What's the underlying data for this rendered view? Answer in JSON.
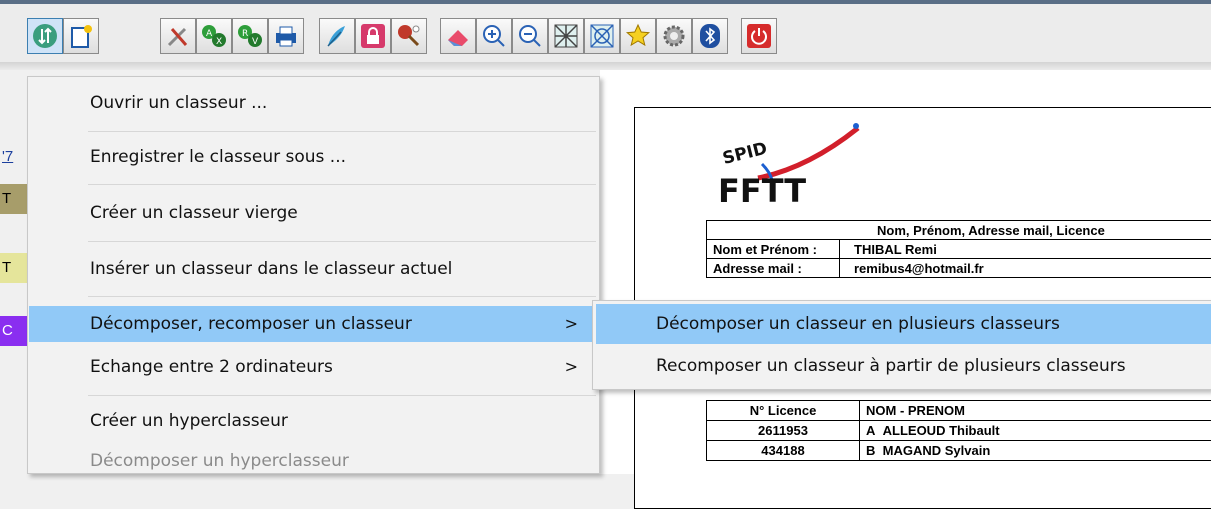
{
  "toolbar": {
    "buttons": [
      {
        "name": "sort-icon"
      },
      {
        "name": "new-workbook-icon"
      },
      {
        "name": "tools-icon"
      },
      {
        "name": "swap-ax-icon"
      },
      {
        "name": "swap-rv-icon"
      },
      {
        "name": "print-icon"
      },
      {
        "name": "feather-icon"
      },
      {
        "name": "lock-icon"
      },
      {
        "name": "ping-pong-icon"
      },
      {
        "name": "eraser-icon"
      },
      {
        "name": "zoom-in-icon"
      },
      {
        "name": "zoom-out-icon"
      },
      {
        "name": "grid-cross-icon"
      },
      {
        "name": "grid-cycle-icon"
      },
      {
        "name": "star-icon"
      },
      {
        "name": "gear-icon"
      },
      {
        "name": "bluetooth-icon"
      },
      {
        "name": "power-icon"
      }
    ]
  },
  "left_strip": [
    "'7",
    "T",
    "T",
    "C"
  ],
  "menu": {
    "items": [
      {
        "label": "Ouvrir un classeur ..."
      },
      {
        "label": "Enregistrer le classeur sous ..."
      },
      {
        "label": "Créer un classeur vierge"
      },
      {
        "label": "Insérer un classeur dans le classeur actuel"
      },
      {
        "label": "Décomposer, recomposer un classeur",
        "arrow": ">"
      },
      {
        "label": "Echange entre 2 ordinateurs",
        "arrow": ">"
      },
      {
        "label": "Créer un hyperclasseur"
      },
      {
        "label": "Décomposer un hyperclasseur"
      }
    ]
  },
  "submenu": {
    "items": [
      {
        "label": "Décomposer un classeur en plusieurs classeurs"
      },
      {
        "label": "Recomposer un classeur à partir de plusieurs classeurs"
      }
    ]
  },
  "document": {
    "logo_top": "SPID",
    "logo_bottom": "FFTT",
    "header": "Nom, Prénom, Adresse mail, Licence",
    "name_label": "Nom et Prénom :",
    "name_value": "THIBAL  Remi",
    "mail_label": "Adresse mail  :",
    "mail_value": "remibus4@hotmail.fr",
    "col_licence": "N° Licence",
    "col_name": "NOM - PRENOM",
    "rows": [
      {
        "licence": "2611953",
        "letter": "A",
        "name": "ALLEOUD  Thibault"
      },
      {
        "licence": "434188",
        "letter": "B",
        "name": "MAGAND  Sylvain"
      }
    ]
  },
  "colors": {
    "highlight": "#91c9f7",
    "menu_bg": "#f2f2f2"
  }
}
